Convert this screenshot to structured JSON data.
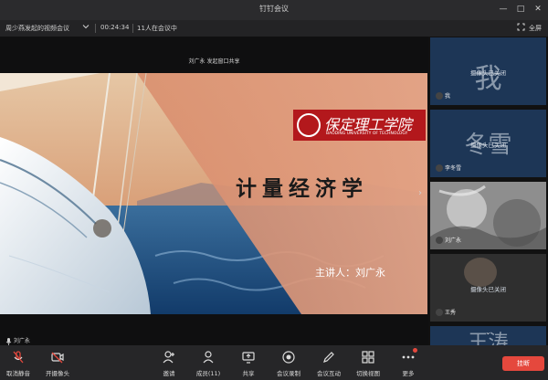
{
  "window": {
    "title": "钉钉会议",
    "minimize": "—",
    "maximize": "□",
    "close": "✕"
  },
  "infobar": {
    "meeting_name": "周少燕发起的视频会议",
    "duration": "00:24:34",
    "participants_status": "11人在会议中",
    "fullscreen_label": "全屏"
  },
  "stage": {
    "share_label": "刘广永 发起窗口共享",
    "speaker_label": "刘广永"
  },
  "slide": {
    "school_logo_text": "保定理工学院",
    "school_english": "BAODING UNIVERSITY OF TECHNOLOGY",
    "course_title": "计量经济学",
    "lecturer": "主讲人：刘广永"
  },
  "participants": [
    {
      "avatar_text": "我",
      "status": "摄像头已关闭",
      "name": "我"
    },
    {
      "avatar_text": "冬雪",
      "status": "摄像头已关闭",
      "name": "李冬雪"
    },
    {
      "avatar_text": "",
      "status": "",
      "name": "刘广永"
    },
    {
      "avatar_text": "",
      "status": "摄像头已关闭",
      "name": "王秀"
    },
    {
      "avatar_text": "王涛",
      "status": "",
      "name": ""
    }
  ],
  "toolbar": {
    "mute_label": "取消静音",
    "camera_label": "开摄像头",
    "invite_label": "邀请",
    "members_label": "成员(11)",
    "share_label": "共享",
    "record_label": "会议录制",
    "interact_label": "会议互动",
    "switch_view_label": "切换视图",
    "more_label": "更多",
    "end_label": "挂断"
  },
  "colors": {
    "accent": "#2f7bf5",
    "end_button": "#e5483d",
    "tile_bg": "#1d3656",
    "slide_peach": "#d8896a",
    "logo_red": "#b3181c"
  }
}
